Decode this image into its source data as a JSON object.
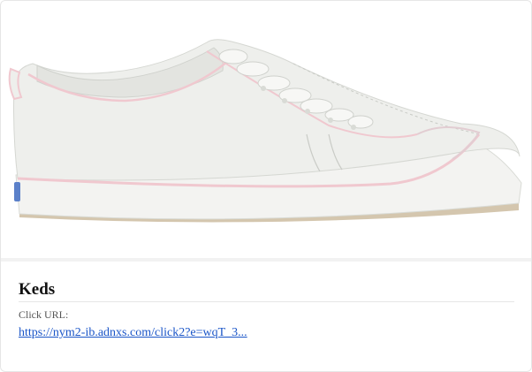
{
  "card": {
    "title": "Keds",
    "click_label": "Click URL:",
    "click_url": "https://nym2-ib.adnxs.com/click2?e=wqT_3..."
  },
  "image": {
    "name": "white-leather-sneaker-image",
    "colors": {
      "body": "#eeefec",
      "shadow": "#d9dbd6",
      "sole": "#f3f3f1",
      "pink_trim": "#f0c8cf",
      "gum": "#c9b89a",
      "heel_tag": "#5b80c9"
    }
  },
  "colors": {
    "link": "#1a55c8",
    "title": "#111111",
    "label": "#555555",
    "border": "#e6e6e6"
  }
}
